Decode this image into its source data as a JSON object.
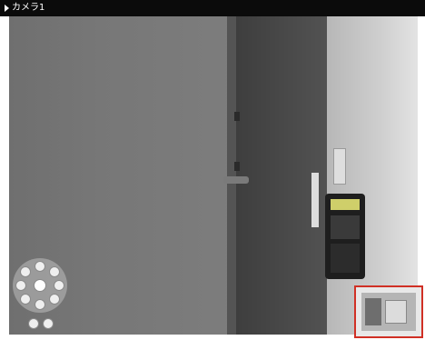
{
  "window": {
    "title": "カメラ1"
  },
  "camera_view": {
    "ptz": {
      "buttons": [
        "up",
        "up-right",
        "right",
        "down-right",
        "down",
        "down-left",
        "left",
        "up-left"
      ],
      "center": "home"
    },
    "zoom": {
      "out_icon": "minus-icon",
      "in_icon": "plus-icon"
    },
    "thumbnail": {
      "accent": "#d03025"
    }
  }
}
